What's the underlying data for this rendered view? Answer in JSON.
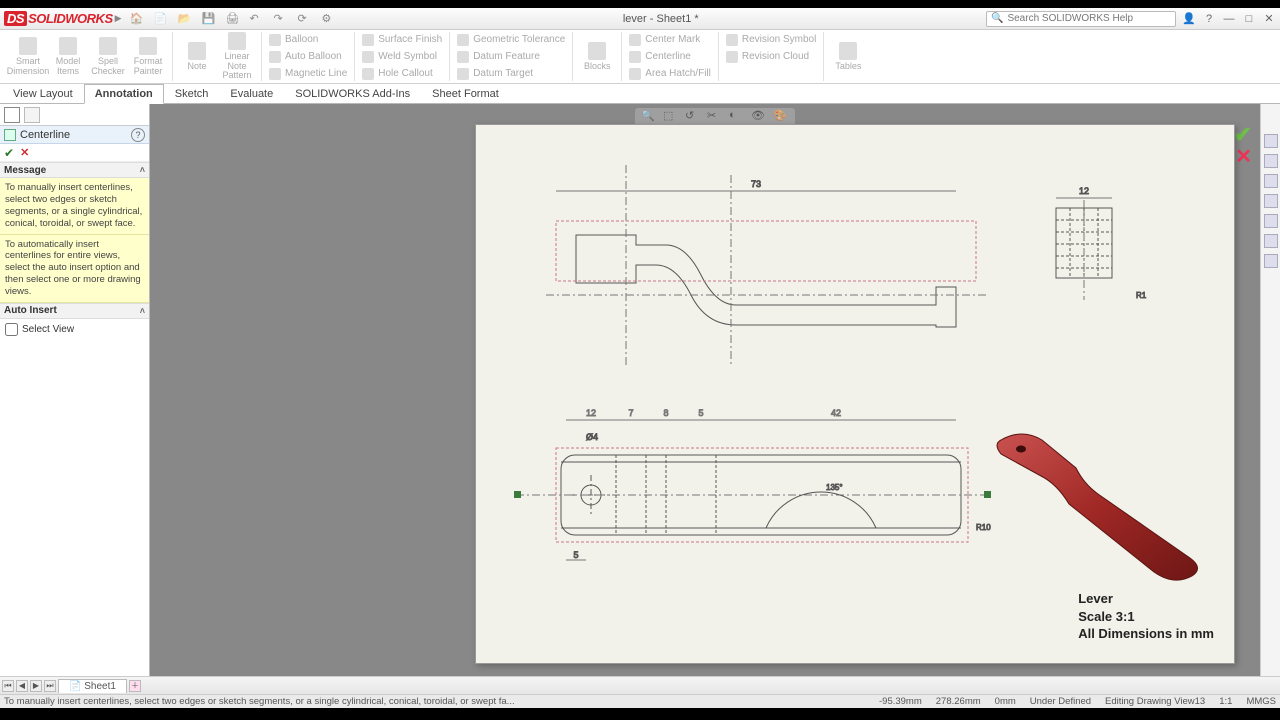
{
  "app_name": "SOLIDWORKS",
  "window_title": "lever - Sheet1 *",
  "search_placeholder": "Search SOLIDWORKS Help",
  "ribbon": {
    "big": {
      "smart_dimension": "Smart\nDimension",
      "model_items": "Model\nItems",
      "spell_checker": "Spell\nChecker",
      "format_painter": "Format\nPainter",
      "note": "Note",
      "linear_note_pattern": "Linear Note\nPattern",
      "blocks": "Blocks",
      "tables": "Tables"
    },
    "small": {
      "balloon": "Balloon",
      "auto_balloon": "Auto Balloon",
      "magnetic_line": "Magnetic Line",
      "surface_finish": "Surface Finish",
      "weld_symbol": "Weld Symbol",
      "hole_callout": "Hole Callout",
      "geometric_tolerance": "Geometric Tolerance",
      "datum_feature": "Datum Feature",
      "datum_target": "Datum Target",
      "center_mark": "Center Mark",
      "centerline": "Centerline",
      "revision_cloud": "Revision Cloud",
      "area_hatch": "Area Hatch/Fill",
      "revision_symbol": "Revision Symbol"
    }
  },
  "tabs": [
    "View Layout",
    "Annotation",
    "Sketch",
    "Evaluate",
    "SOLIDWORKS Add-Ins",
    "Sheet Format"
  ],
  "active_tab": "Annotation",
  "propmgr": {
    "title": "Centerline",
    "section_message": "Message",
    "msg1": "To manually insert centerlines, select two edges or sketch segments, or a single cylindrical, conical, toroidal, or swept face.",
    "msg2": "To automatically insert centerlines for entire views, select the auto insert option and then select one or more drawing views.",
    "section_auto": "Auto Insert",
    "select_view": "Select View"
  },
  "drawing": {
    "title_lines": [
      "Lever",
      "Scale 3:1",
      "All Dimensions in mm"
    ],
    "dims": {
      "d73": "73",
      "d12a": "12",
      "d12b": "12",
      "d7": "7",
      "d8": "8",
      "d5a": "5",
      "d5b": "5",
      "d42": "42",
      "r1": "R1",
      "r2": "R10",
      "phi4": "Ø4",
      "ang": "135°"
    }
  },
  "sheet_tab": "Sheet1",
  "statusbar": {
    "hint": "To manually insert centerlines, select two edges or sketch segments, or a single cylindrical, conical, toroidal, or swept fa...",
    "x": "-95.39mm",
    "y": "278.26mm",
    "z": "0mm",
    "state": "Under Defined",
    "mode": "Editing Drawing View13",
    "scale": "1:1",
    "units": "MMGS"
  }
}
